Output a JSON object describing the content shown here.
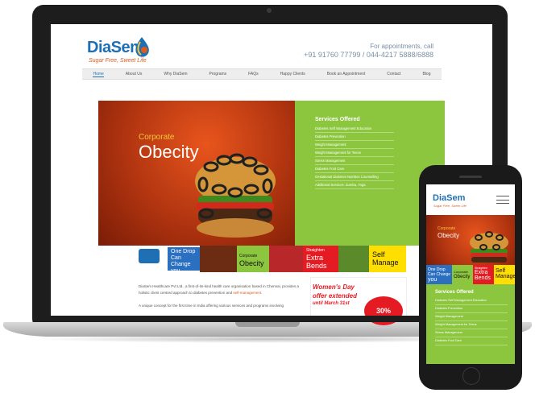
{
  "site": {
    "logo_text": "DiaSem",
    "tagline": "Sugar Free, Sweet Life",
    "appointment_label": "For appointments, call",
    "appointment_phone": "+91 91760 77799 / 044-4217 5888/6888"
  },
  "nav": {
    "items": [
      "Home",
      "About Us",
      "Why DiaSem",
      "Programs",
      "FAQs",
      "Happy Clients",
      "Book an Appointment",
      "Contact",
      "Blog"
    ],
    "active": "Home"
  },
  "banner": {
    "line1": "Corporate",
    "line2": "Obecity"
  },
  "services": {
    "title": "Services Offered",
    "items": [
      "Diabetes Self Management Education",
      "Diabetes Prevention",
      "Weight Management",
      "Weight Management for Teens",
      "Stress Management",
      "Diabetes Foot Care",
      "Gestational Diabetes Nutrition Counselling",
      "Additional Services: Zumba, Yoga"
    ]
  },
  "strips": {
    "one_drop": [
      "One Drop",
      "Can Change",
      "you"
    ],
    "corporate": [
      "Corporate",
      "Obecity"
    ],
    "extra_bends": [
      "Straighten",
      "Extra",
      "Bends"
    ],
    "self_manage": [
      "Self",
      "Manage"
    ]
  },
  "body": {
    "para1": "DiaSem Healthcare Pvt Ltd., a first-of-its-kind health care organisation based in Chennai, provides a holistic client centred approach to diabetes prevention and",
    "para1_link": "self-management.",
    "para2": "A unique concept for the first time in India offering various services and programs involving"
  },
  "promo": {
    "line1": "Women's Day",
    "line2": "offer extended",
    "line3": "until March 31st",
    "badge": "30%"
  },
  "phone": {
    "logo_text": "DiaSem",
    "tagline": "Sugar Free, Sweet Life",
    "banner_line1": "Corporate",
    "banner_line2": "Obecity",
    "strip1": [
      "One Drop",
      "Can Change",
      "you"
    ],
    "strip2": [
      "Corporate",
      "Obecity"
    ],
    "strip3": [
      "Straighten",
      "Extra",
      "Bends"
    ],
    "strip4": [
      "Self",
      "Manage"
    ],
    "services_title": "Services Offered",
    "services": [
      "Diabetes Self Management Education",
      "Diabetes Prevention",
      "Weight Management",
      "Weight Management for Teens",
      "Stress Management",
      "Diabetes Foot Care"
    ]
  },
  "colors": {
    "brand_blue": "#1f6fb5",
    "accent_orange": "#e05a1e",
    "services_green": "#8cc63f",
    "strip_red": "#e41b23",
    "strip_yellow": "#ffde00"
  }
}
